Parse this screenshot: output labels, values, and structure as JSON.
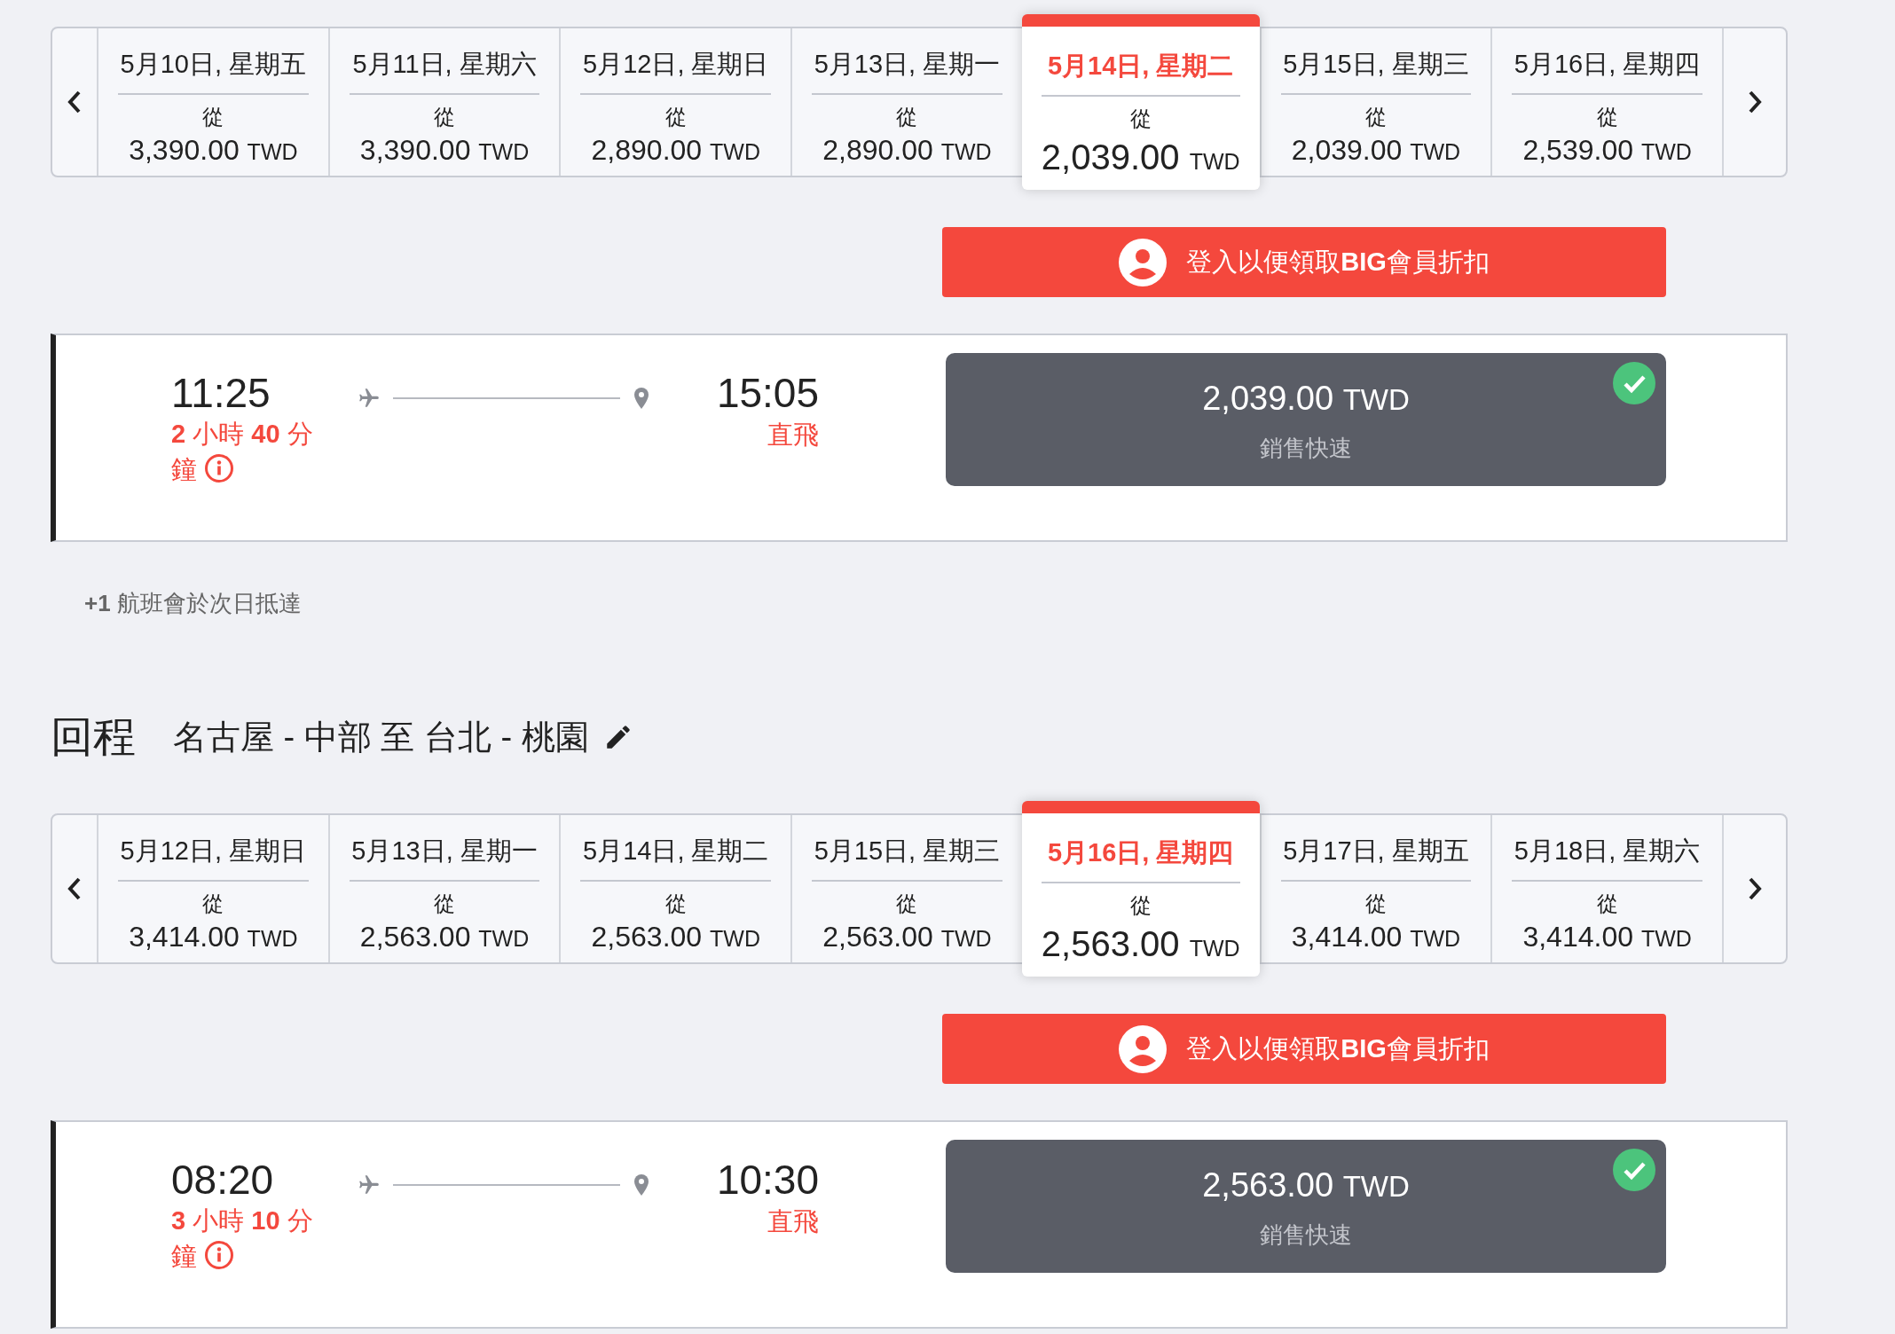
{
  "outbound": {
    "dates": [
      {
        "date": "5月10日, 星期五",
        "from": "從",
        "price": "3,390.00",
        "currency": "TWD",
        "selected": false
      },
      {
        "date": "5月11日, 星期六",
        "from": "從",
        "price": "3,390.00",
        "currency": "TWD",
        "selected": false
      },
      {
        "date": "5月12日, 星期日",
        "from": "從",
        "price": "2,890.00",
        "currency": "TWD",
        "selected": false
      },
      {
        "date": "5月13日, 星期一",
        "from": "從",
        "price": "2,890.00",
        "currency": "TWD",
        "selected": false
      },
      {
        "date": "5月14日, 星期二",
        "from": "從",
        "price": "2,039.00",
        "currency": "TWD",
        "selected": true
      },
      {
        "date": "5月15日, 星期三",
        "from": "從",
        "price": "2,039.00",
        "currency": "TWD",
        "selected": false
      },
      {
        "date": "5月16日, 星期四",
        "from": "從",
        "price": "2,539.00",
        "currency": "TWD",
        "selected": false
      }
    ],
    "login_button": "登入以便領取**BIG**會員折扣",
    "flight": {
      "depart": "11:25",
      "duration": "**2** 小時 **40** 分鐘",
      "arrive": "15:05",
      "stops": "直飛",
      "fare": {
        "price": "2,039.00",
        "currency": "TWD",
        "note": "銷售快速",
        "selected": true
      }
    },
    "note": "**+1** 航班會於次日抵達"
  },
  "return": {
    "title": "回程",
    "route": "名古屋 - 中部 至 台北 - 桃園",
    "dates": [
      {
        "date": "5月12日, 星期日",
        "from": "從",
        "price": "3,414.00",
        "currency": "TWD",
        "selected": false
      },
      {
        "date": "5月13日, 星期一",
        "from": "從",
        "price": "2,563.00",
        "currency": "TWD",
        "selected": false
      },
      {
        "date": "5月14日, 星期二",
        "from": "從",
        "price": "2,563.00",
        "currency": "TWD",
        "selected": false
      },
      {
        "date": "5月15日, 星期三",
        "from": "從",
        "price": "2,563.00",
        "currency": "TWD",
        "selected": false
      },
      {
        "date": "5月16日, 星期四",
        "from": "從",
        "price": "2,563.00",
        "currency": "TWD",
        "selected": true
      },
      {
        "date": "5月17日, 星期五",
        "from": "從",
        "price": "3,414.00",
        "currency": "TWD",
        "selected": false
      },
      {
        "date": "5月18日, 星期六",
        "from": "從",
        "price": "3,414.00",
        "currency": "TWD",
        "selected": false
      }
    ],
    "login_button": "登入以便領取**BIG**會員折扣",
    "flight": {
      "depart": "08:20",
      "duration": "**3** 小時 **10** 分鐘",
      "arrive": "10:30",
      "stops": "直飛",
      "fare": {
        "price": "2,563.00",
        "currency": "TWD",
        "note": "銷售快速",
        "selected": true
      }
    }
  }
}
